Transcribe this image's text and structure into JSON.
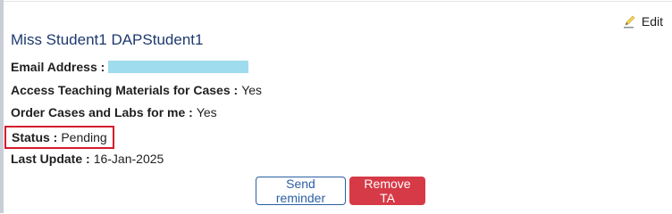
{
  "header": {
    "edit_label": "Edit"
  },
  "student": {
    "name": "Miss Student1 DAPStudent1"
  },
  "fields": {
    "email": {
      "label": "Email Address :",
      "value": ""
    },
    "access_materials": {
      "label": "Access Teaching Materials for Cases :",
      "value": "Yes"
    },
    "order_cases": {
      "label": "Order Cases and Labs for me :",
      "value": "Yes"
    },
    "status": {
      "label": "Status :",
      "value": "Pending"
    },
    "last_update": {
      "label": "Last Update :",
      "value": "16-Jan-2025"
    }
  },
  "actions": {
    "send_reminder_label": "Send reminder",
    "remove_ta_label": "Remove TA"
  },
  "colors": {
    "name_text": "#1e3a6e",
    "status_highlight": "#d21c2c",
    "redaction": "#9fdced",
    "primary_outline": "#2b5fa5",
    "danger": "#d63a47"
  },
  "icons": {
    "edit": "pencil-icon"
  }
}
